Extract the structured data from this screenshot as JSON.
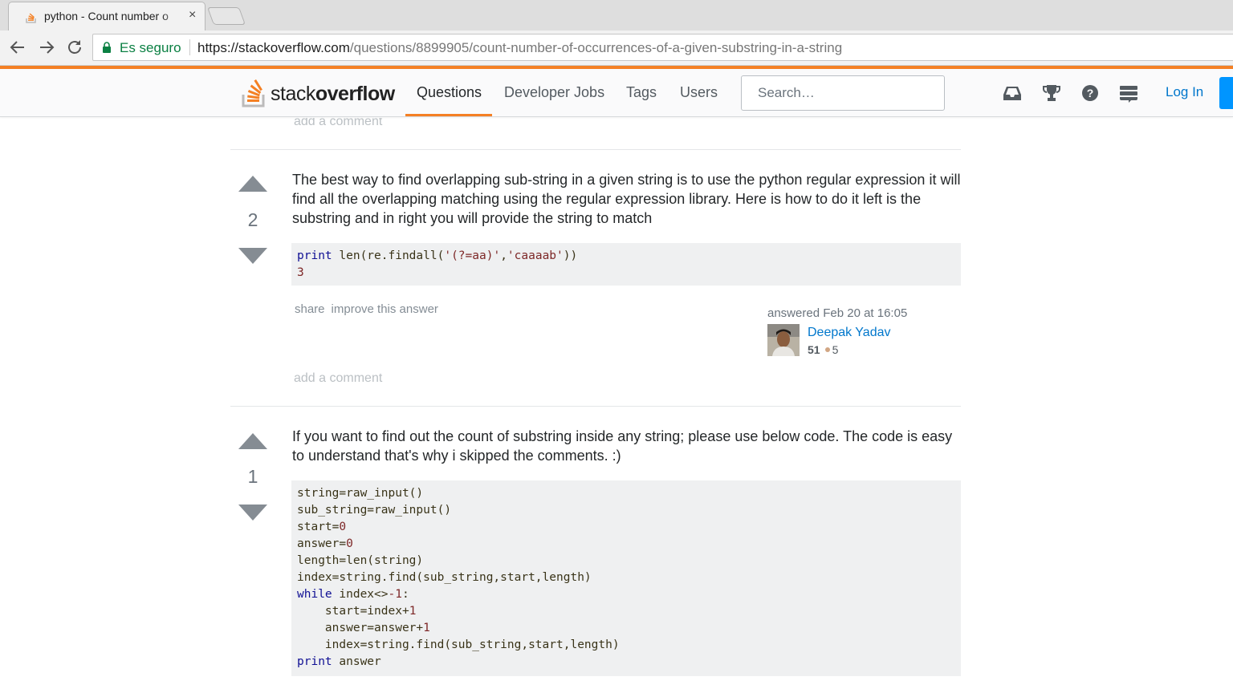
{
  "browser": {
    "tab_title": "python - Count number o",
    "tab_close": "×",
    "secure_label": "Es seguro",
    "url_host": "https://stackoverflow.com",
    "url_path": "/questions/8899905/count-number-of-occurrences-of-a-given-substring-in-a-string"
  },
  "header": {
    "logo_light": "stack",
    "logo_bold": "overflow",
    "nav": [
      "Questions",
      "Developer Jobs",
      "Tags",
      "Users"
    ],
    "search_placeholder": "Search…",
    "login_label": "Log In"
  },
  "colors": {
    "accent": "#f48024",
    "link": "#0077cc",
    "code_bg": "#eff0f1"
  },
  "top_comment_link": "add a comment",
  "answers": [
    {
      "votes": "2",
      "text": "The best way to find overlapping sub-string in a given string is to use the python regular expression it will find all the overlapping matching using the regular expression library. Here is how to do it left is the substring and in right you will provide the string to match",
      "code_lines": [
        "print len(re.findall('(?=aa)','caaaab'))",
        "3"
      ],
      "menu": [
        "share",
        "improve this answer"
      ],
      "answered": "answered Feb 20 at 16:05",
      "user_name": "Deepak Yadav",
      "user_rep": "51",
      "bronze_badges": "5",
      "comment_link": "add a comment"
    },
    {
      "votes": "1",
      "text": "If you want to find out the count of substring inside any string; please use below code. The code is easy to understand that's why i skipped the comments. :)",
      "code_lines": [
        "string=raw_input()",
        "sub_string=raw_input()",
        "start=0",
        "answer=0",
        "length=len(string)",
        "index=string.find(sub_string,start,length)",
        "while index<>-1:",
        "    start=index+1",
        "    answer=answer+1",
        "    index=string.find(sub_string,start,length)",
        "print answer"
      ]
    }
  ]
}
